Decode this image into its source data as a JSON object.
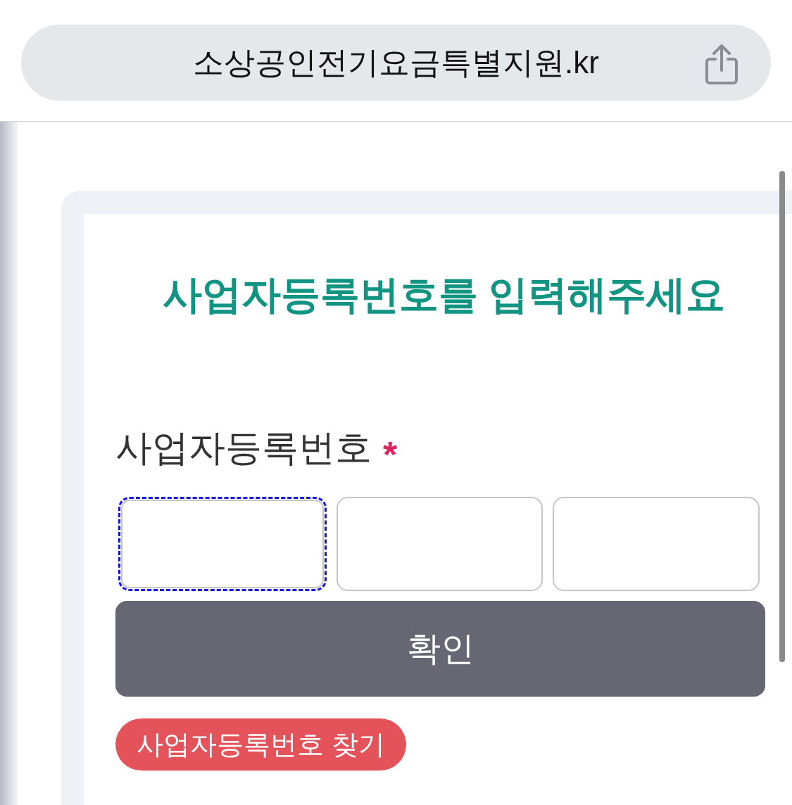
{
  "address_bar": {
    "url": "소상공인전기요금특별지원.kr"
  },
  "form": {
    "title": "사업자등록번호를 입력해주세요",
    "field": {
      "label": "사업자등록번호",
      "required": true,
      "required_mark": "*"
    },
    "inputs": [
      {
        "focused": true
      },
      {
        "focused": false
      },
      {
        "focused": false
      }
    ],
    "confirm_button": "확인",
    "find_link": "사업자등록번호 찾기"
  }
}
